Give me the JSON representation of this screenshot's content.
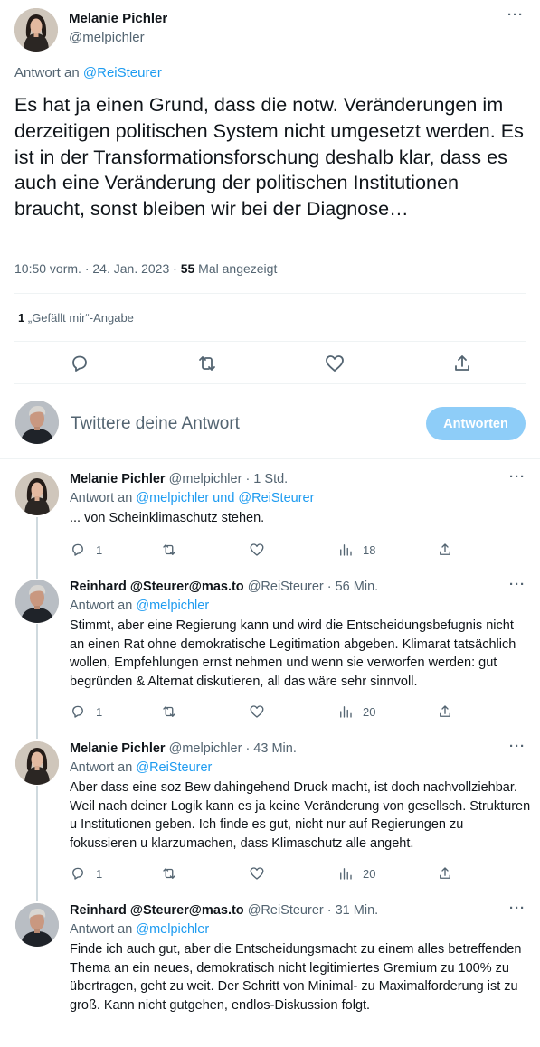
{
  "main_tweet": {
    "author_name": "Melanie Pichler",
    "author_handle": "@melpichler",
    "more_label": "···",
    "reply_to_prefix": "Antwort an",
    "reply_to_handle": "@ReiSteurer",
    "text": "Es hat ja einen Grund, dass die notw. Veränderungen im derzeitigen politischen System nicht umgesetzt werden. Es ist in der Transformationsforschung deshalb klar, dass es auch eine Veränderung der politischen Institutionen braucht, sonst bleiben wir bei der Diagnose…",
    "time": "10:50 vorm.",
    "date": "24. Jan. 2023",
    "views_count": "55",
    "views_label": "Mal angezeigt",
    "likes_count": "1",
    "likes_label": "„Gefällt mir“-Angabe",
    "actions": [
      "reply-icon",
      "retweet-icon",
      "like-icon",
      "share-icon"
    ]
  },
  "composer": {
    "placeholder": "Twittere deine Antwort",
    "button_label": "Antworten",
    "button_color": "#8ecdf8"
  },
  "replies": [
    {
      "author_name": "Melanie Pichler",
      "author_handle": "@melpichler",
      "time": "· 1 Std.",
      "reply_to_prefix": "Antwort an",
      "reply_to": "@melpichler und @ReiSteurer",
      "text": "... von Scheinklimaschutz stehen.",
      "reply_count": "1",
      "views": "18"
    },
    {
      "author_name": "Reinhard @Steurer@mas.to",
      "author_handle": "@ReiSteurer",
      "time": "· 56 Min.",
      "reply_to_prefix": "Antwort an",
      "reply_to": "@melpichler",
      "text": "Stimmt, aber eine Regierung kann und wird die Entscheidungsbefugnis nicht an einen Rat ohne demokratische Legitimation abgeben. Klimarat tatsächlich wollen, Empfehlungen ernst nehmen und wenn sie verworfen werden: gut begründen & Alternat diskutieren, all das wäre sehr sinnvoll.",
      "reply_count": "1",
      "views": "20"
    },
    {
      "author_name": "Melanie Pichler",
      "author_handle": "@melpichler",
      "time": "· 43 Min.",
      "reply_to_prefix": "Antwort an",
      "reply_to": "@ReiSteurer",
      "text": "Aber dass eine soz Bew dahingehend Druck macht, ist doch nachvollziehbar. Weil nach deiner Logik kann es ja keine Veränderung von gesellsch. Strukturen u Institutionen geben. Ich finde es gut, nicht nur auf Regierungen zu fokussieren u klarzumachen, dass Klimaschutz alle angeht.",
      "reply_count": "1",
      "views": "20"
    },
    {
      "author_name": "Reinhard @Steurer@mas.to",
      "author_handle": "@ReiSteurer",
      "time": "· 31 Min.",
      "reply_to_prefix": "Antwort an",
      "reply_to": "@melpichler",
      "text": "Finde ich auch gut, aber die Entscheidungsmacht zu einem alles betreffenden Thema an ein neues, demokratisch nicht legitimiertes Gremium zu 100% zu übertragen, geht zu weit. Der Schritt von Minimal- zu Maximalforderung ist zu groß. Kann nicht gutgehen, endlos-Diskussion folgt."
    }
  ],
  "colors": {
    "accent": "#1d9bf0",
    "muted_text": "#536471",
    "thread_line": "#cfd9de"
  }
}
